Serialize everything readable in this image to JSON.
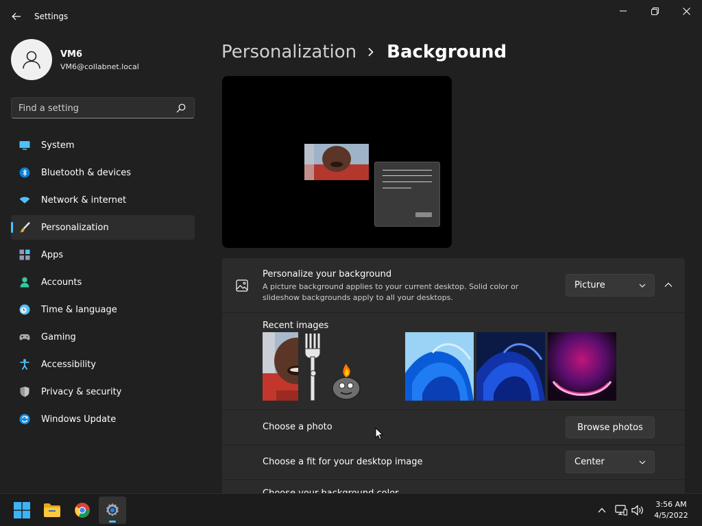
{
  "window": {
    "title": "Settings"
  },
  "user": {
    "name": "VM6",
    "email": "VM6@collabnet.local"
  },
  "search": {
    "placeholder": "Find a setting"
  },
  "sidebar": {
    "items": [
      {
        "label": "System",
        "icon": "system-icon"
      },
      {
        "label": "Bluetooth & devices",
        "icon": "bluetooth-icon"
      },
      {
        "label": "Network & internet",
        "icon": "wifi-icon"
      },
      {
        "label": "Personalization",
        "icon": "brush-icon",
        "selected": true
      },
      {
        "label": "Apps",
        "icon": "apps-icon"
      },
      {
        "label": "Accounts",
        "icon": "accounts-icon"
      },
      {
        "label": "Time & language",
        "icon": "clock-globe-icon"
      },
      {
        "label": "Gaming",
        "icon": "gamepad-icon"
      },
      {
        "label": "Accessibility",
        "icon": "accessibility-icon"
      },
      {
        "label": "Privacy & security",
        "icon": "shield-icon"
      },
      {
        "label": "Windows Update",
        "icon": "update-icon"
      }
    ]
  },
  "breadcrumb": {
    "parent": "Personalization",
    "current": "Background"
  },
  "background": {
    "title": "Personalize your background",
    "description": "A picture background applies to your current desktop. Solid color or slideshow backgrounds apply to all your desktops.",
    "type_value": "Picture",
    "recent_label": "Recent images",
    "recent_images": [
      {
        "icon": "recent-image-person"
      },
      {
        "icon": "recent-image-fork-cartoon"
      },
      {
        "icon": "recent-image-bloom-light-blue"
      },
      {
        "icon": "recent-image-bloom-dark-blue"
      },
      {
        "icon": "recent-image-purple-glow"
      }
    ],
    "choose_photo_label": "Choose a photo",
    "browse_label": "Browse photos",
    "fit_label": "Choose a fit for your desktop image",
    "fit_value": "Center",
    "color_label": "Choose your background color"
  },
  "taskbar": {
    "time": "3:56 AM",
    "date": "4/5/2022"
  },
  "colors": {
    "accent": "#4cc2ff",
    "window_bg": "#202020",
    "card_bg": "#2b2b2b",
    "taskbar_bg": "#1c1c1c"
  }
}
